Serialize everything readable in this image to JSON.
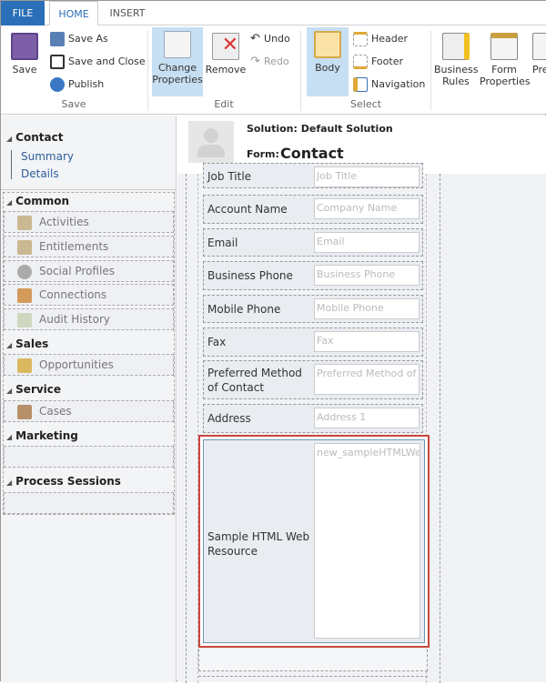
{
  "tabs": [
    {
      "label": "FILE",
      "active": false
    },
    {
      "label": "HOME",
      "active": true
    },
    {
      "label": "INSERT",
      "active": false
    }
  ],
  "ribbon": {
    "save": {
      "save": "Save",
      "save_as": "Save As",
      "save_close": "Save and Close",
      "publish": "Publish",
      "group": "Save"
    },
    "edit": {
      "change_properties": "Change Properties",
      "remove": "Remove",
      "undo": "Undo",
      "redo": "Redo",
      "group": "Edit"
    },
    "select": {
      "body": "Body",
      "header": "Header",
      "footer": "Footer",
      "navigation": "Navigation",
      "group": "Select"
    },
    "other": {
      "business_rules": "Business Rules",
      "form_properties": "Form Properties",
      "preview": "Pre"
    }
  },
  "nav": {
    "contact": "Contact",
    "summary": "Summary",
    "details": "Details",
    "common": "Common",
    "common_items": [
      "Activities",
      "Entitlements",
      "Social Profiles",
      "Connections",
      "Audit History"
    ],
    "sales": "Sales",
    "sales_items": [
      "Opportunities"
    ],
    "service": "Service",
    "service_items": [
      "Cases"
    ],
    "marketing": "Marketing",
    "process": "Process Sessions"
  },
  "header": {
    "solution": "Solution: Default Solution",
    "form_label": "Form:",
    "form_name": "Contact"
  },
  "fields": [
    {
      "label": "Job Title",
      "placeholder": "Job Title"
    },
    {
      "label": "Account Name",
      "placeholder": "Company Name"
    },
    {
      "label": "Email",
      "placeholder": "Email"
    },
    {
      "label": "Business Phone",
      "placeholder": "Business Phone"
    },
    {
      "label": "Mobile Phone",
      "placeholder": "Mobile Phone"
    },
    {
      "label": "Fax",
      "placeholder": "Fax"
    },
    {
      "label": "Preferred Method of Contact",
      "placeholder": "Preferred Method of Contact"
    },
    {
      "label": "Address",
      "placeholder": "Address 1"
    }
  ],
  "web_resource": {
    "label": "Sample HTML Web Resource",
    "value": "new_sampleHTMLWebResource"
  },
  "colors": {
    "file_tab": "#2b6fb8",
    "selected_button": "#c7dff2",
    "highlight": "#c9463d"
  }
}
